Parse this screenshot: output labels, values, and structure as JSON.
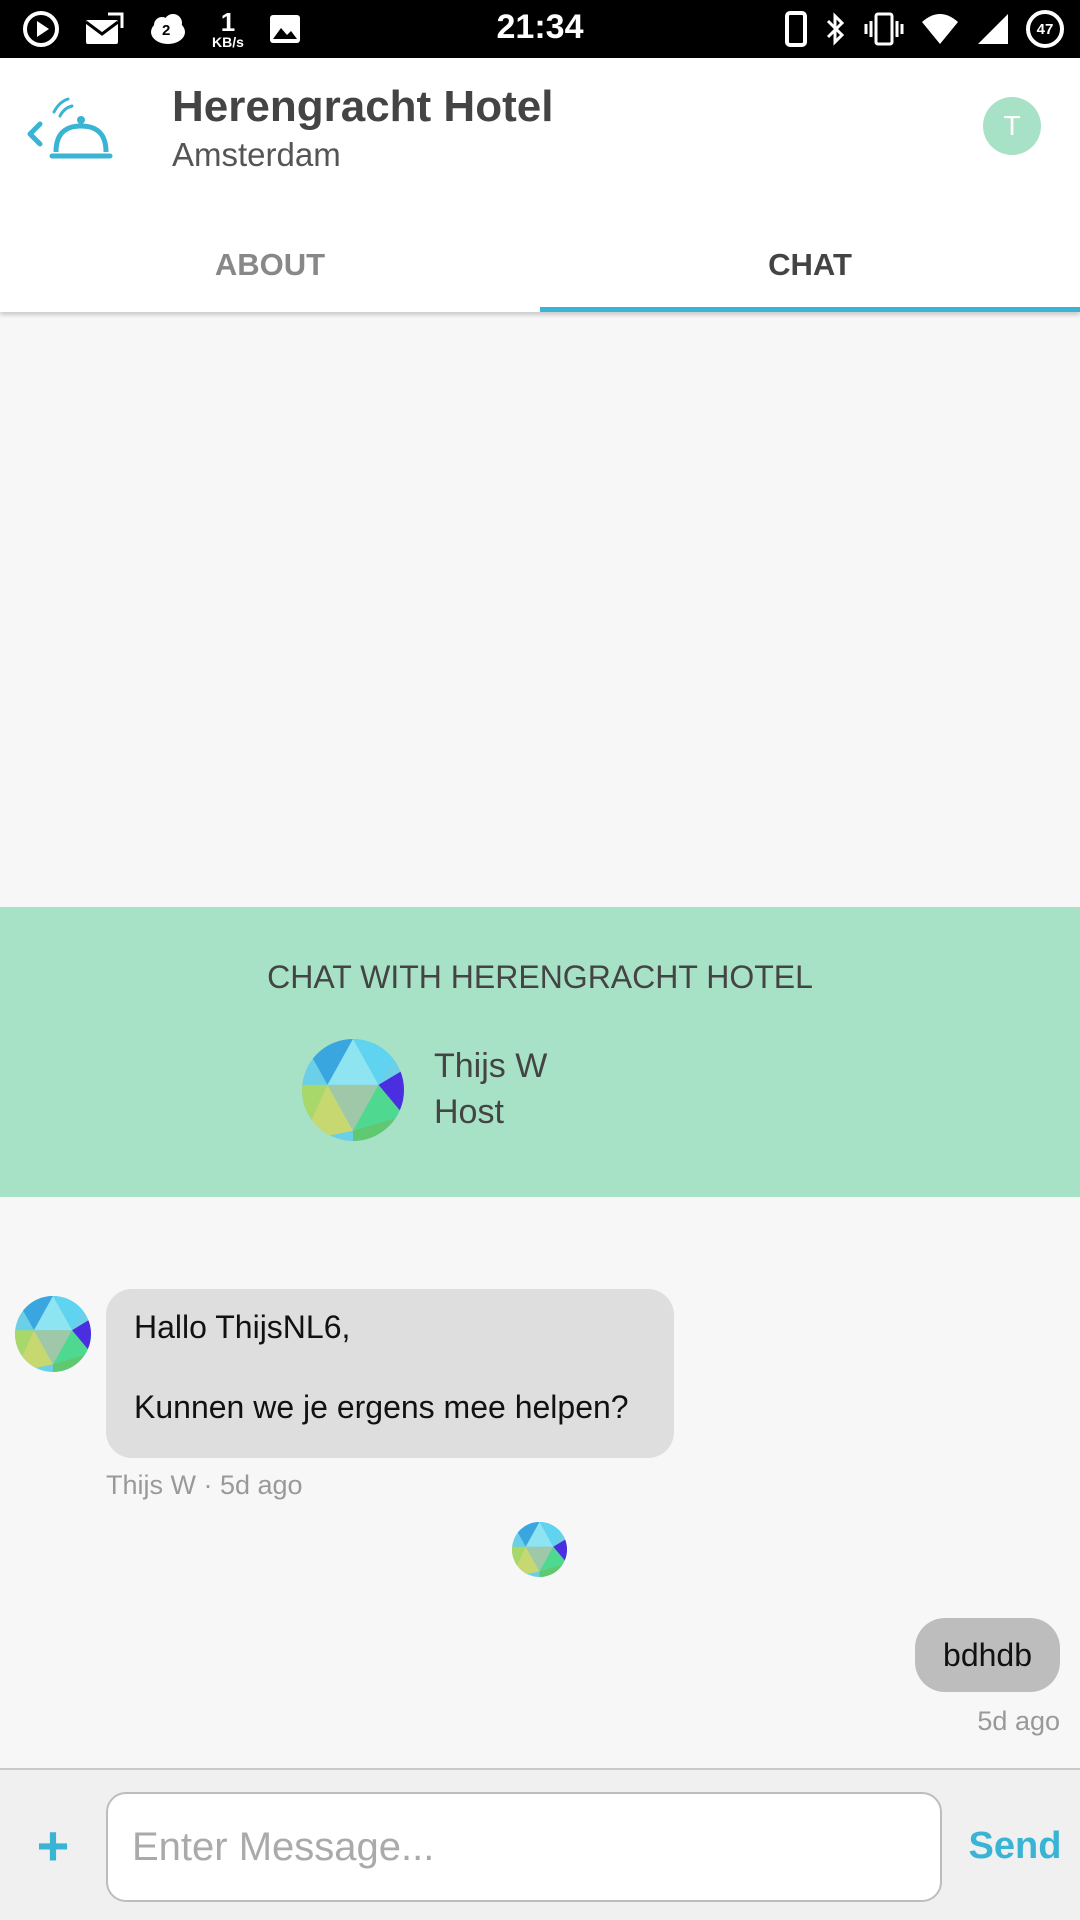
{
  "status_bar": {
    "time": "21:34",
    "speed_value": "1",
    "speed_unit": "KB/s",
    "notification_count": "2",
    "battery_level": "47",
    "left_icons": [
      "play-icon",
      "mail-icon",
      "cloud-icon",
      "image-icon"
    ],
    "right_icons": [
      "phone-icon",
      "bluetooth-icon",
      "vibrate-icon",
      "wifi-icon",
      "signal-icon",
      "battery-icon"
    ]
  },
  "header": {
    "title": "Herengracht Hotel",
    "subtitle": "Amsterdam",
    "user_initial": "T",
    "back_icon": "back-bell-icon"
  },
  "tabs": [
    {
      "label": "ABOUT",
      "active": false
    },
    {
      "label": "CHAT",
      "active": true
    }
  ],
  "banner": {
    "title": "CHAT WITH HERENGRACHT HOTEL",
    "host_name": "Thijs W",
    "host_role": "Host"
  },
  "messages": [
    {
      "direction": "incoming",
      "line1": "Hallo ThijsNL6,",
      "line2": "Kunnen we je ergens mee helpen?",
      "meta": "Thijs W · 5d ago"
    },
    {
      "direction": "outgoing",
      "text": "bdhdb",
      "meta": "5d ago"
    }
  ],
  "composer": {
    "placeholder": "Enter Message...",
    "value": "",
    "send_label": "Send",
    "attach_label": "+"
  },
  "colors": {
    "accent": "#3ab4d4",
    "banner_bg": "#a8e2c6",
    "incoming_bubble": "#dedede",
    "outgoing_bubble": "#bdbdbd",
    "background": "#f7f7f7"
  }
}
